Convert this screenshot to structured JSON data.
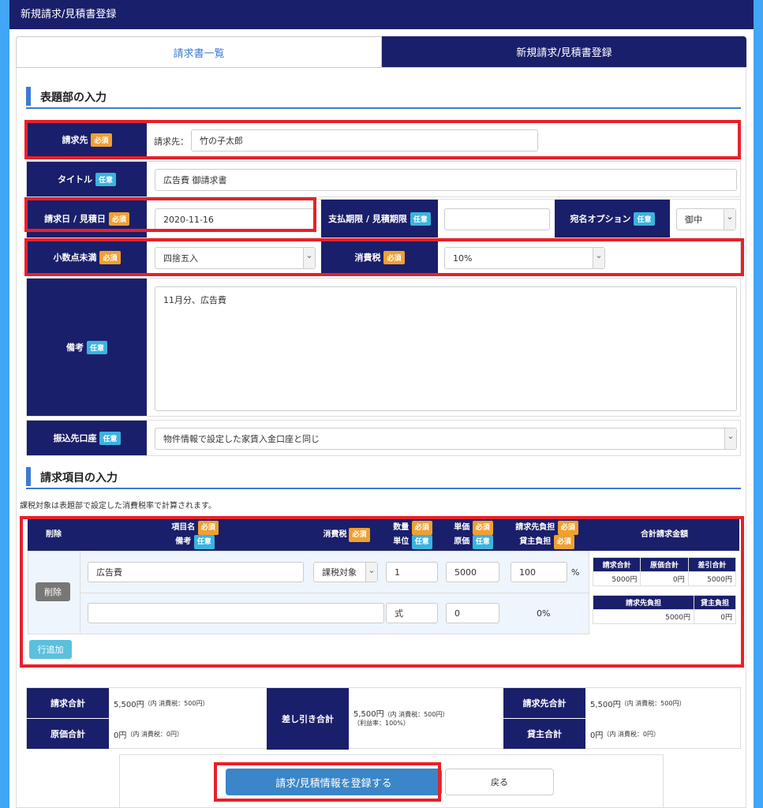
{
  "topbar": {
    "title": "新規請求/見積書登録"
  },
  "tabs": [
    {
      "label": "請求書一覧"
    },
    {
      "label": "新規請求/見積書登録"
    }
  ],
  "badges": {
    "required": "必須",
    "optional": "任意"
  },
  "header_section": {
    "title": "表題部の入力",
    "billing_to": {
      "label": "請求先",
      "prefix": "請求先：",
      "value": "竹の子太郎"
    },
    "title_field": {
      "label": "タイトル",
      "value": "広告費 御請求書"
    },
    "billing_date": {
      "label": "請求日 / 見積日",
      "value": "2020-11-16"
    },
    "payment_due": {
      "label": "支払期限 / 見積期限",
      "value": ""
    },
    "addressee": {
      "label": "宛名オプション",
      "value": "御中"
    },
    "decimal": {
      "label": "小数点未満",
      "value": "四捨五入"
    },
    "tax": {
      "label": "消費税",
      "value": "10%"
    },
    "notes": {
      "label": "備考",
      "value": "11月分、広告費"
    },
    "bank_account": {
      "label": "振込先口座",
      "value": "物件情報で設定した家賃入金口座と同じ"
    }
  },
  "items_section": {
    "title": "請求項目の入力",
    "note": "課税対象は表題部で設定した消費税率で計算されます。",
    "headers": {
      "delete": "削除",
      "item_name": "項目名",
      "remark": "備考",
      "tax": "消費税",
      "qty": "数量",
      "unit": "単位",
      "price": "単価",
      "cost": "原価",
      "client_share": "請求先負担",
      "owner_share": "貸主負担",
      "total": "合計請求金額"
    },
    "row": {
      "delete_label": "削除",
      "item_name": "広告費",
      "remark": "",
      "tax": "課税対象",
      "qty": "1",
      "unit": "式",
      "price": "5000",
      "cost": "0",
      "client_share": "100",
      "percent_sign": "%",
      "owner_share": "0%",
      "mini": {
        "h1": "請求合計",
        "h2": "原価合計",
        "h3": "差引合計",
        "v1": "5000円",
        "v2": "0円",
        "v3": "5000円",
        "h4": "請求先負担",
        "h5": "貸主負担",
        "v4": "5000円",
        "v5": "0円"
      }
    },
    "add_row": "行追加"
  },
  "summary": {
    "billing_total": {
      "label": "請求合計",
      "value": "5,500円",
      "tax": "（内 消費税：500円）"
    },
    "cost_total": {
      "label": "原価合計",
      "value": "0円",
      "tax": "（内 消費税：0円）"
    },
    "diff_total": {
      "label": "差し引き合計",
      "value": "5,500円",
      "tax": "（内 消費税：500円）",
      "margin": "（利益率：100%）"
    },
    "client_total": {
      "label": "請求先合計",
      "value": "5,500円",
      "tax": "（内 消費税：500円）"
    },
    "owner_total": {
      "label": "貸主合計",
      "value": "0円",
      "tax": "（内 消費税：0円）"
    }
  },
  "actions": {
    "submit": "請求/見積情報を登録する",
    "back": "戻る"
  },
  "colors": {
    "navy": "#1a1f6b",
    "accent": "#3a7bd5",
    "required": "#f0a030",
    "optional": "#3bb3e0",
    "highlight": "#e8202a"
  }
}
